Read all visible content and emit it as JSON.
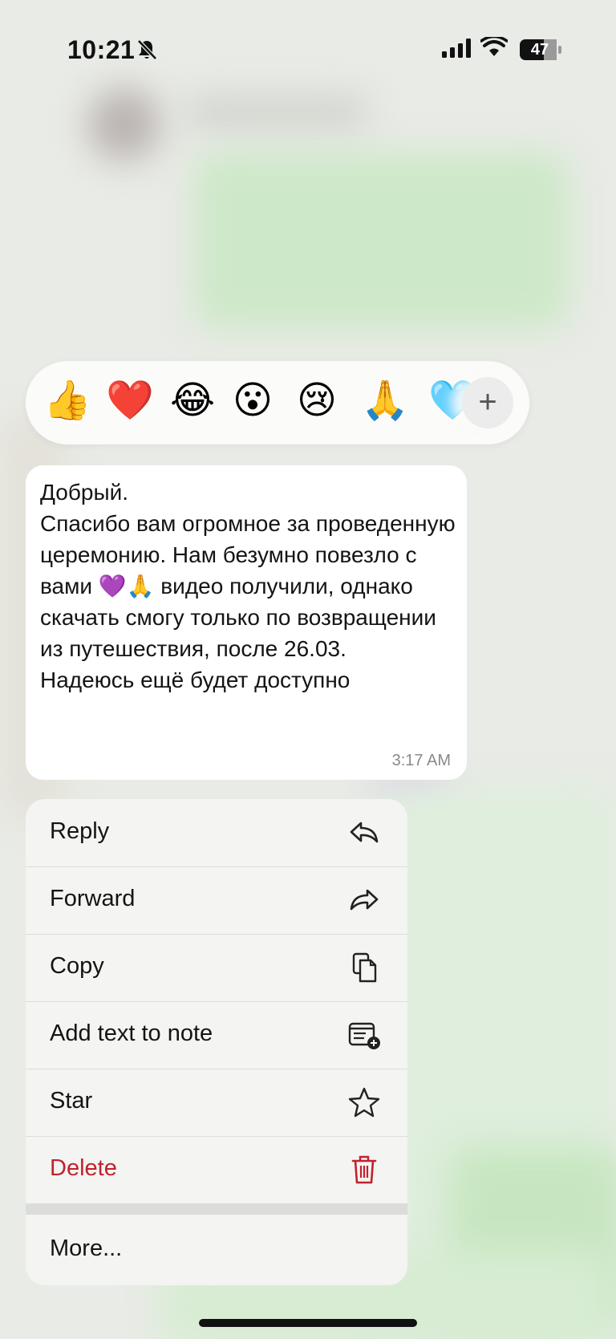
{
  "status_bar": {
    "time": "10:21",
    "battery": "47",
    "icons": [
      "bell-off-icon",
      "signal-icon",
      "wifi-icon",
      "battery-icon"
    ]
  },
  "reactions": {
    "emojis": [
      "👍",
      "❤️",
      "😂",
      "😮",
      "😢",
      "🙏",
      "🩵"
    ],
    "add_icon": "+"
  },
  "message": {
    "text": "Добрый.\nСпасибо вам огромное за проведенную церемонию. Нам безумно повезло с вами 💜🙏 видео получили, однако скачать смогу только по возвращении из путешествия, после 26.03.\nНадеюсь ещё будет доступно",
    "time": "3:17 AM"
  },
  "menu": {
    "items": [
      {
        "label": "Reply",
        "icon": "reply-icon"
      },
      {
        "label": "Forward",
        "icon": "forward-icon"
      },
      {
        "label": "Copy",
        "icon": "copy-icon"
      },
      {
        "label": "Add text to note",
        "icon": "add-note-icon"
      },
      {
        "label": "Star",
        "icon": "star-icon"
      },
      {
        "label": "Delete",
        "icon": "trash-icon"
      }
    ],
    "more_label": "More..."
  },
  "colors": {
    "delete": "#c0222e",
    "menu_bg": "#f4f4f2",
    "bubble_bg": "#ffffff"
  }
}
